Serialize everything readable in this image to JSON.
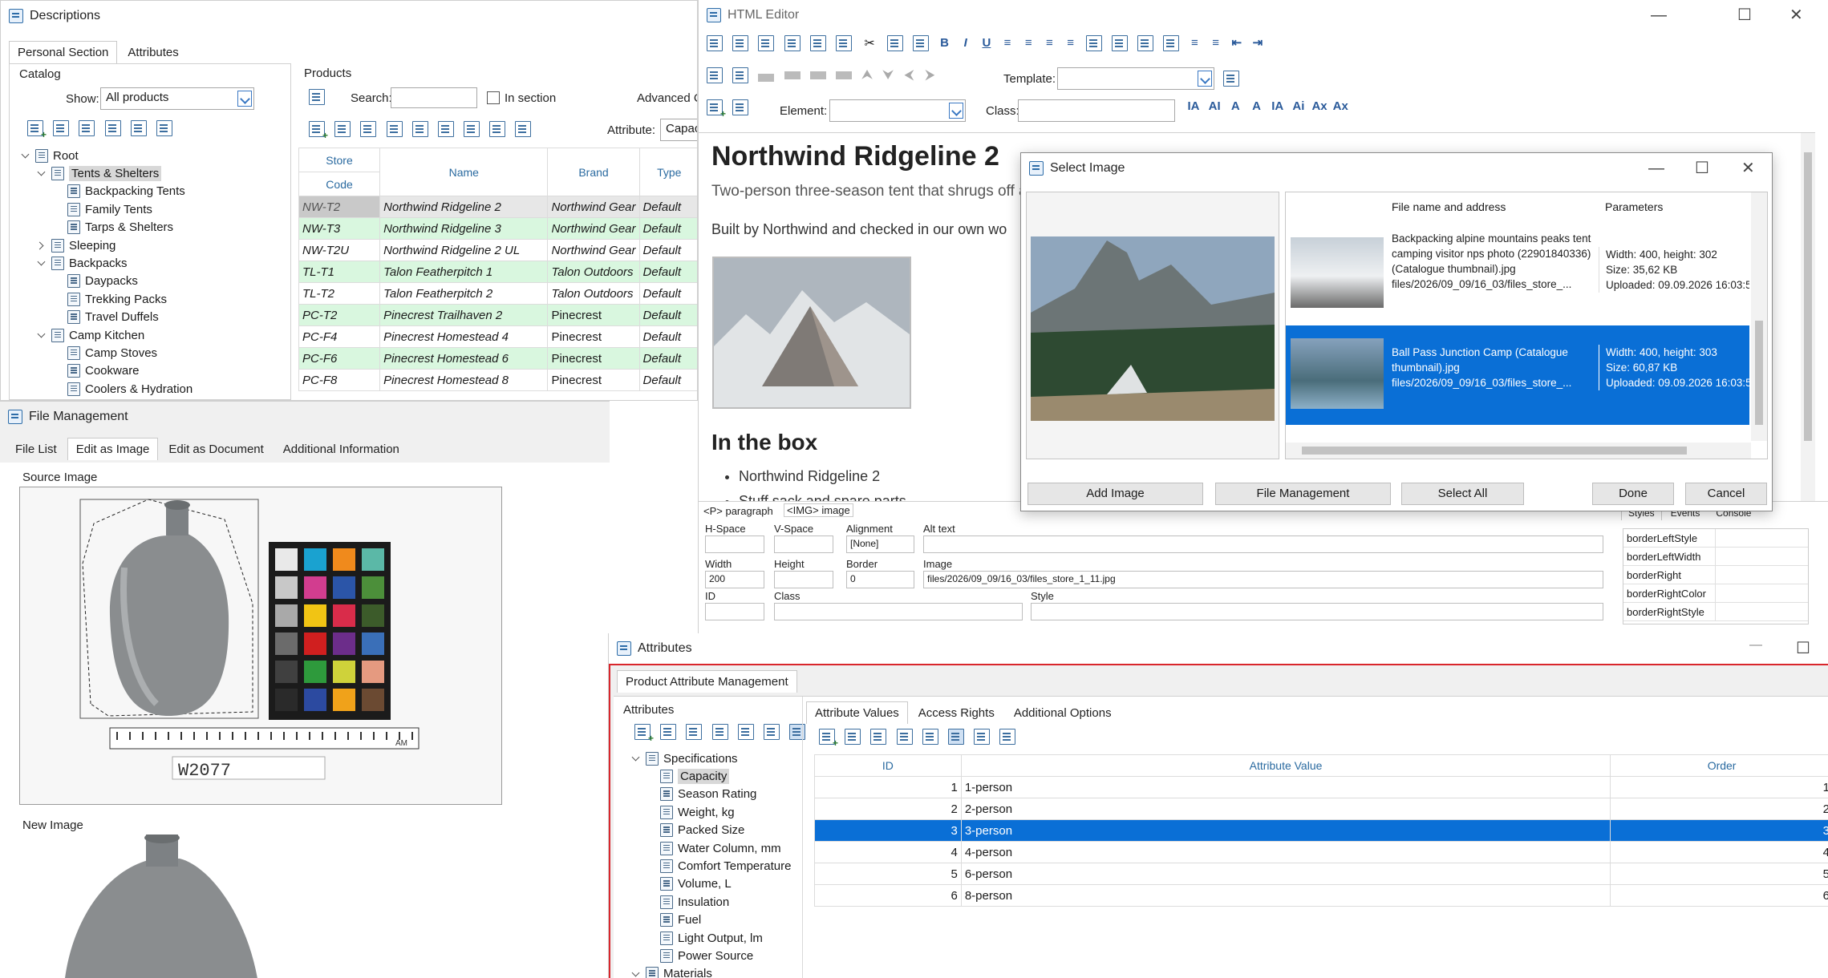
{
  "descriptions": {
    "title": "Descriptions",
    "tabs": [
      "Personal Section",
      "Attributes"
    ],
    "catalog_label": "Catalog",
    "show_label": "Show:",
    "show_value": "All products",
    "products_label": "Products",
    "search_label": "Search:",
    "in_section_label": "In section",
    "advanced_label": "Advanced C",
    "attribute_label": "Attribute:",
    "attribute_value": "Capac",
    "tree": [
      {
        "label": "Root",
        "level": 0,
        "state": "open"
      },
      {
        "label": "Tents & Shelters",
        "level": 1,
        "state": "open",
        "selected": true
      },
      {
        "label": "Backpacking Tents",
        "level": 2
      },
      {
        "label": "Family Tents",
        "level": 2
      },
      {
        "label": "Tarps & Shelters",
        "level": 2
      },
      {
        "label": "Sleeping",
        "level": 1,
        "state": "closed"
      },
      {
        "label": "Backpacks",
        "level": 1,
        "state": "open"
      },
      {
        "label": "Daypacks",
        "level": 2
      },
      {
        "label": "Trekking Packs",
        "level": 2
      },
      {
        "label": "Travel Duffels",
        "level": 2
      },
      {
        "label": "Camp Kitchen",
        "level": 1,
        "state": "open"
      },
      {
        "label": "Camp Stoves",
        "level": 2
      },
      {
        "label": "Cookware",
        "level": 2
      },
      {
        "label": "Coolers & Hydration",
        "level": 2
      }
    ],
    "columns": {
      "store": "Store",
      "code": "Code",
      "name": "Name",
      "brand": "Brand",
      "type": "Type"
    },
    "rows": [
      {
        "code": "NW-T2",
        "name": "Northwind Ridgeline 2",
        "brand": "Northwind Gear",
        "type": "Default",
        "style": "current"
      },
      {
        "code": "NW-T3",
        "name": "Northwind Ridgeline 3",
        "brand": "Northwind Gear",
        "type": "Default",
        "style": "green"
      },
      {
        "code": "NW-T2U",
        "name": "Northwind Ridgeline 2 UL",
        "brand": "Northwind Gear",
        "type": "Default",
        "style": "plain"
      },
      {
        "code": "TL-T1",
        "name": "Talon Featherpitch 1",
        "brand": "Talon Outdoors",
        "type": "Default",
        "style": "green"
      },
      {
        "code": "TL-T2",
        "name": "Talon Featherpitch 2",
        "brand": "Talon Outdoors",
        "type": "Default",
        "style": "plain"
      },
      {
        "code": "PC-T2",
        "name": "Pinecrest Trailhaven 2",
        "brand": "Pinecrest",
        "type": "Default",
        "style": "green"
      },
      {
        "code": "PC-F4",
        "name": "Pinecrest Homestead 4",
        "brand": "Pinecrest",
        "type": "Default",
        "style": "plain"
      },
      {
        "code": "PC-F6",
        "name": "Pinecrest Homestead 6",
        "brand": "Pinecrest",
        "type": "Default",
        "style": "green"
      },
      {
        "code": "PC-F8",
        "name": "Pinecrest Homestead 8",
        "brand": "Pinecrest",
        "type": "Default",
        "style": "plain"
      }
    ]
  },
  "file_management": {
    "title": "File Management",
    "tabs": [
      "File List",
      "Edit as Image",
      "Edit as Document",
      "Additional Information"
    ],
    "source_label": "Source Image",
    "new_label": "New Image",
    "specimen_label": "W2077",
    "ruler_mark": "AM"
  },
  "html_editor": {
    "title": "HTML Editor",
    "template_label": "Template:",
    "element_label": "Element:",
    "class_label": "Class:",
    "heading": "Northwind Ridgeline 2",
    "subtitle": "Two-person three-season tent that shrugs off a",
    "body_text": "Built by Northwind and checked in our own wo",
    "box_heading": "In the box",
    "box_items": [
      "Northwind Ridgeline 2",
      "Stuff sack and spare parts"
    ],
    "path_tags": [
      "<P> paragraph",
      "<IMG> image"
    ],
    "props": {
      "hspace_label": "H-Space",
      "vspace_label": "V-Space",
      "alignment_label": "Alignment",
      "alignment_value": "[None]",
      "alt_label": "Alt text",
      "width_label": "Width",
      "width_value": "200",
      "height_label": "Height",
      "border_label": "Border",
      "border_value": "0",
      "image_label": "Image",
      "image_value": "files/2026/09_09/16_03/files_store_1_11.jpg",
      "id_label": "ID",
      "class_label": "Class",
      "style_label": "Style"
    },
    "side_tabs": [
      "Styles",
      "Events",
      "Console"
    ],
    "style_props": [
      "borderLeftStyle",
      "borderLeftWidth",
      "borderRight",
      "borderRightColor",
      "borderRightStyle"
    ]
  },
  "select_image": {
    "title": "Select Image",
    "col_file": "File name and address",
    "col_params": "Parameters",
    "items": [
      {
        "file": "Backpacking alpine mountains peaks tent camping visitor nps photo (22901840336) (Catalogue thumbnail).jpg",
        "path": "files/2026/09_09/16_03/files_store_...",
        "size_line": "Width: 400, height: 302",
        "kb": "Size: 35,62 KB",
        "uploaded": "Uploaded: 09.09.2026 16:03:5",
        "selected": false
      },
      {
        "file": "Ball Pass Junction Camp (Catalogue thumbnail).jpg",
        "path": "files/2026/09_09/16_03/files_store_...",
        "size_line": "Width: 400, height: 303",
        "kb": "Size: 60,87 KB",
        "uploaded": "Uploaded: 09.09.2026 16:03:5",
        "selected": true
      }
    ],
    "buttons": {
      "add": "Add Image",
      "files": "File Management",
      "select_all": "Select All",
      "done": "Done",
      "cancel": "Cancel"
    }
  },
  "attributes": {
    "title": "Attributes",
    "tab": "Product Attribute Management",
    "attributes_label": "Attributes",
    "tree_root": "Specifications",
    "tree": [
      "Capacity",
      "Season Rating",
      "Weight, kg",
      "Packed Size",
      "Water Column, mm",
      "Comfort Temperature",
      "Volume, L",
      "Insulation",
      "Fuel",
      "Light Output, lm",
      "Power Source"
    ],
    "tree_next": "Materials",
    "tabs": [
      "Attribute Values",
      "Access Rights",
      "Additional Options"
    ],
    "columns": {
      "id": "ID",
      "value": "Attribute Value",
      "order": "Order"
    },
    "rows": [
      {
        "id": "1",
        "value": "1-person",
        "order": "1"
      },
      {
        "id": "2",
        "value": "2-person",
        "order": "2"
      },
      {
        "id": "3",
        "value": "3-person",
        "order": "3",
        "selected": true
      },
      {
        "id": "4",
        "value": "4-person",
        "order": "4"
      },
      {
        "id": "5",
        "value": "6-person",
        "order": "5"
      },
      {
        "id": "6",
        "value": "8-person",
        "order": "6"
      }
    ]
  },
  "colors": {
    "selection": "#0a6fd6",
    "green_row": "#d9f7df",
    "accent": "#2a6aa0",
    "red_border": "#d9262c"
  }
}
